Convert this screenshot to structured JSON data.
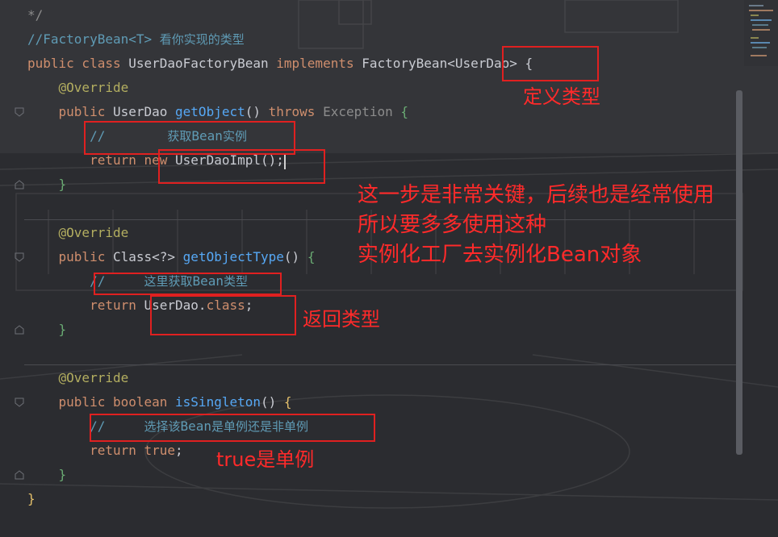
{
  "editor": {
    "lines": [
      {
        "segs": [
          {
            "t": "*/",
            "c": "gray"
          }
        ]
      },
      {
        "segs": [
          {
            "t": "//FactoryBean<T> ",
            "c": "cm"
          },
          {
            "t": "看你实现的类型",
            "c": "cm-cn"
          }
        ]
      },
      {
        "segs": [
          {
            "t": "public class ",
            "c": "kw"
          },
          {
            "t": "UserDaoFactoryBean ",
            "c": "cls"
          },
          {
            "t": "implements ",
            "c": "kw"
          },
          {
            "t": "FactoryBean<UserDao> {",
            "c": "cls"
          }
        ]
      },
      {
        "segs": [
          {
            "t": "    @Override",
            "c": "ann"
          }
        ]
      },
      {
        "segs": [
          {
            "t": "    public ",
            "c": "kw"
          },
          {
            "t": "UserDao ",
            "c": "cls"
          },
          {
            "t": "getObject",
            "c": "fn"
          },
          {
            "t": "() ",
            "c": "cls"
          },
          {
            "t": "throws ",
            "c": "kw"
          },
          {
            "t": "Exception ",
            "c": "gray"
          },
          {
            "t": "{",
            "c": "grn"
          }
        ]
      },
      {
        "segs": [
          {
            "t": "        //        ",
            "c": "cm"
          },
          {
            "t": "获取",
            "c": "cm-cn"
          },
          {
            "t": "Bean",
            "c": "cm"
          },
          {
            "t": "实例",
            "c": "cm-cn"
          }
        ]
      },
      {
        "segs": [
          {
            "t": "        return new ",
            "c": "kw"
          },
          {
            "t": "UserDaoImpl();",
            "c": "cls"
          }
        ],
        "caret": true
      },
      {
        "segs": [
          {
            "t": "    }",
            "c": "grn"
          }
        ]
      },
      {
        "segs": []
      },
      {
        "segs": [
          {
            "t": "    @Override",
            "c": "ann"
          }
        ]
      },
      {
        "segs": [
          {
            "t": "    public ",
            "c": "kw"
          },
          {
            "t": "Class<?> ",
            "c": "cls"
          },
          {
            "t": "getObjectType",
            "c": "fn"
          },
          {
            "t": "() ",
            "c": "cls"
          },
          {
            "t": "{",
            "c": "grn"
          }
        ]
      },
      {
        "segs": [
          {
            "t": "        //     ",
            "c": "cm"
          },
          {
            "t": "这里获取",
            "c": "cm-cn"
          },
          {
            "t": "Bean",
            "c": "cm"
          },
          {
            "t": "类型",
            "c": "cm-cn"
          }
        ]
      },
      {
        "segs": [
          {
            "t": "        return ",
            "c": "kw"
          },
          {
            "t": "UserDao.",
            "c": "cls"
          },
          {
            "t": "class",
            "c": "kw"
          },
          {
            "t": ";",
            "c": "cls"
          }
        ]
      },
      {
        "segs": [
          {
            "t": "    }",
            "c": "grn"
          }
        ]
      },
      {
        "segs": []
      },
      {
        "segs": [
          {
            "t": "    @Override",
            "c": "ann"
          }
        ]
      },
      {
        "segs": [
          {
            "t": "    public ",
            "c": "kw"
          },
          {
            "t": "boolean ",
            "c": "kw"
          },
          {
            "t": "isSingleton",
            "c": "fn"
          },
          {
            "t": "() ",
            "c": "cls"
          },
          {
            "t": "{",
            "c": "ylw"
          }
        ]
      },
      {
        "segs": [
          {
            "t": "        //     ",
            "c": "cm"
          },
          {
            "t": "选择该",
            "c": "cm-cn"
          },
          {
            "t": "Bean",
            "c": "cm"
          },
          {
            "t": "是单例还是非单例",
            "c": "cm-cn"
          }
        ]
      },
      {
        "segs": [
          {
            "t": "        return ",
            "c": "kw"
          },
          {
            "t": "true",
            "c": "kw"
          },
          {
            "t": ";",
            "c": "cls"
          }
        ]
      },
      {
        "segs": [
          {
            "t": "    }",
            "c": "grn"
          }
        ]
      },
      {
        "segs": [
          {
            "t": "}",
            "c": "ylw"
          }
        ]
      }
    ]
  },
  "annotations": {
    "define_type": "定义类型",
    "key_step": [
      "这一步是非常关键，后续也是经常使用",
      "所以要多多使用这种",
      "实例化工厂去实例化Bean对象"
    ],
    "return_type": "返回类型",
    "singleton": "true是单例"
  },
  "colors": {
    "background": "#2b2c30",
    "keyword": "#cf8e6d",
    "method": "#56a8f5",
    "annotation": "#b3ae60",
    "comment": "#5f9bb5",
    "highlight": "#e02020"
  }
}
